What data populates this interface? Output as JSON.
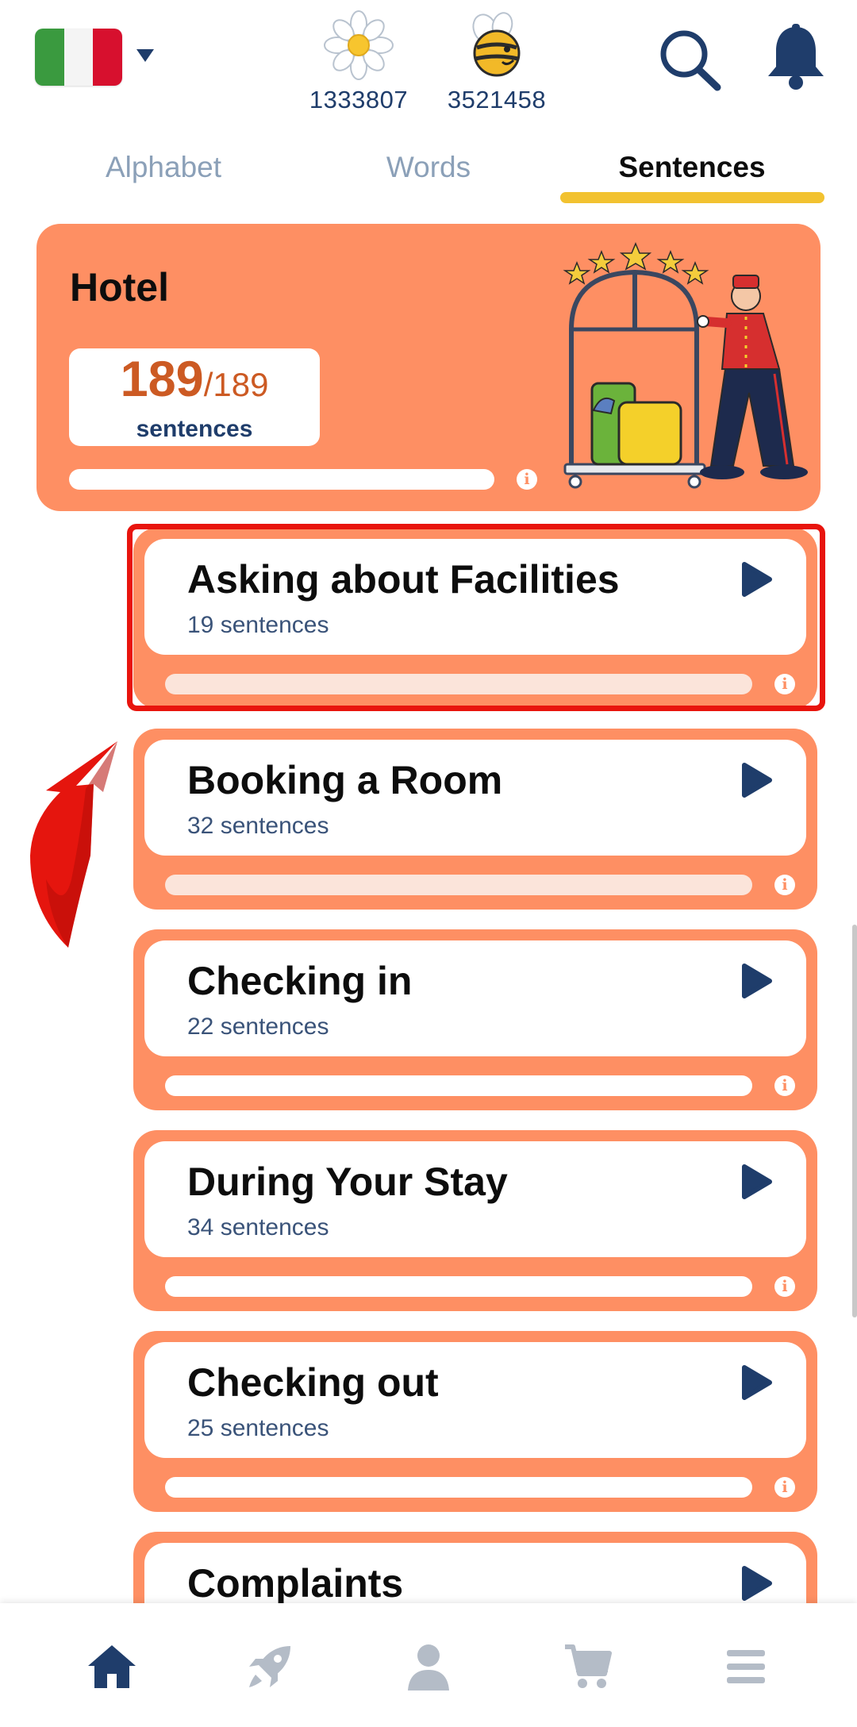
{
  "header": {
    "language": "Italian",
    "stats": [
      {
        "icon": "daisy-icon",
        "value": "1333807"
      },
      {
        "icon": "bee-icon",
        "value": "3521458"
      }
    ]
  },
  "tabs": [
    {
      "label": "Alphabet",
      "active": false
    },
    {
      "label": "Words",
      "active": false
    },
    {
      "label": "Sentences",
      "active": true
    }
  ],
  "hero": {
    "title": "Hotel",
    "completed": "189",
    "total": "/189",
    "unit": "sentences",
    "progress": 0
  },
  "lessons": [
    {
      "title": "Asking about Facilities",
      "subtitle": "19 sentences",
      "highlighted": true
    },
    {
      "title": "Booking a Room",
      "subtitle": "32 sentences"
    },
    {
      "title": "Checking in",
      "subtitle": "22 sentences"
    },
    {
      "title": "During Your Stay",
      "subtitle": "34 sentences"
    },
    {
      "title": "Checking out",
      "subtitle": "25 sentences"
    },
    {
      "title": "Complaints",
      "subtitle": ""
    }
  ],
  "bottom_nav": [
    "home-icon",
    "rocket-icon",
    "profile-icon",
    "cart-icon",
    "menu-icon"
  ],
  "colors": {
    "card": "#fe8f63",
    "accent_underline": "#f2c230",
    "navy": "#1f3d6b",
    "highlight": "#e8140d"
  }
}
